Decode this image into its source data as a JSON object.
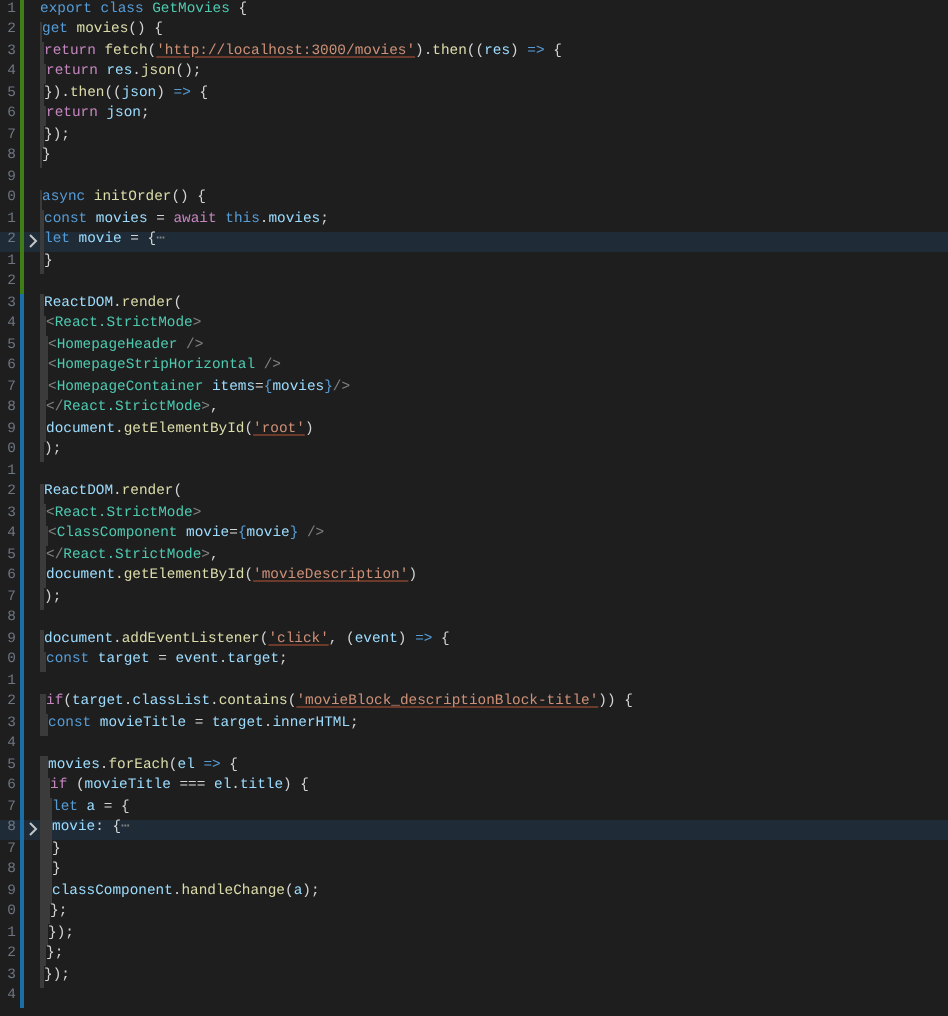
{
  "editor": {
    "lines": [
      {
        "number": "1",
        "added": true,
        "folded": false,
        "tokens": [
          {
            "kind": "kw",
            "text": "export class "
          },
          {
            "kind": "type",
            "text": "GetMovies"
          },
          {
            "kind": "p",
            "text": " {"
          }
        ]
      },
      {
        "number": "2",
        "added": true,
        "folded": false,
        "tokens": [
          {
            "kind": "kw",
            "text": "  get "
          },
          {
            "kind": "fn",
            "text": "movies"
          },
          {
            "kind": "p",
            "text": "() {"
          }
        ]
      },
      {
        "number": "3",
        "added": true,
        "folded": false,
        "tokens": [
          {
            "kind": "ctl",
            "text": "    return "
          },
          {
            "kind": "fn",
            "text": "fetch"
          },
          {
            "kind": "p",
            "text": "("
          },
          {
            "kind": "str",
            "text": "'http://localhost:3000/movies'"
          },
          {
            "kind": "p",
            "text": ")."
          },
          {
            "kind": "fn",
            "text": "then"
          },
          {
            "kind": "p",
            "text": "(("
          },
          {
            "kind": "var",
            "text": "res"
          },
          {
            "kind": "p",
            "text": ") "
          },
          {
            "kind": "kw",
            "text": "=>"
          },
          {
            "kind": "p",
            "text": " {"
          }
        ]
      },
      {
        "number": "4",
        "added": true,
        "folded": false,
        "tokens": [
          {
            "kind": "ctl",
            "text": "      return "
          },
          {
            "kind": "var",
            "text": "res"
          },
          {
            "kind": "p",
            "text": "."
          },
          {
            "kind": "fn",
            "text": "json"
          },
          {
            "kind": "p",
            "text": "();"
          }
        ]
      },
      {
        "number": "5",
        "added": true,
        "folded": false,
        "tokens": [
          {
            "kind": "p",
            "text": "    })."
          },
          {
            "kind": "fn",
            "text": "then"
          },
          {
            "kind": "p",
            "text": "(("
          },
          {
            "kind": "var",
            "text": "json"
          },
          {
            "kind": "p",
            "text": ") "
          },
          {
            "kind": "kw",
            "text": "=>"
          },
          {
            "kind": "p",
            "text": " {"
          }
        ]
      },
      {
        "number": "6",
        "added": true,
        "folded": false,
        "tokens": [
          {
            "kind": "ctl",
            "text": "      return "
          },
          {
            "kind": "var",
            "text": "json"
          },
          {
            "kind": "p",
            "text": ";"
          }
        ]
      },
      {
        "number": "7",
        "added": true,
        "folded": false,
        "tokens": [
          {
            "kind": "p",
            "text": "    });"
          }
        ]
      },
      {
        "number": "8",
        "added": true,
        "folded": false,
        "tokens": [
          {
            "kind": "p",
            "text": "  }"
          }
        ]
      },
      {
        "number": "9",
        "added": true,
        "folded": false
      },
      {
        "number": "0",
        "added": true,
        "folded": false,
        "tokens": [
          {
            "kind": "kw",
            "text": "  async "
          },
          {
            "kind": "fn",
            "text": "initOrder"
          },
          {
            "kind": "p",
            "text": "() {"
          }
        ]
      },
      {
        "number": "1",
        "added": true,
        "folded": false,
        "tokens": [
          {
            "kind": "kw",
            "text": "    const "
          },
          {
            "kind": "var",
            "text": "movies"
          },
          {
            "kind": "p",
            "text": " = "
          },
          {
            "kind": "ctl",
            "text": "await "
          },
          {
            "kind": "kw",
            "text": "this"
          },
          {
            "kind": "p",
            "text": "."
          },
          {
            "kind": "var",
            "text": "movies"
          },
          {
            "kind": "p",
            "text": ";"
          }
        ]
      },
      {
        "number": "2",
        "added": true,
        "folded": true,
        "tokens": [
          {
            "kind": "kw",
            "text": "    let "
          },
          {
            "kind": "var",
            "text": "movie"
          },
          {
            "kind": "p",
            "text": " = {"
          },
          {
            "kind": "fold",
            "text": "⋯"
          }
        ]
      },
      {
        "number": "1",
        "added": true,
        "folded": false,
        "tokens": [
          {
            "kind": "p",
            "text": "    }"
          }
        ]
      },
      {
        "number": "2",
        "added": true,
        "folded": false
      },
      {
        "number": "3",
        "added": false,
        "folded": false,
        "tokens": [
          {
            "kind": "var",
            "text": "    ReactDOM"
          },
          {
            "kind": "p",
            "text": "."
          },
          {
            "kind": "fn",
            "text": "render"
          },
          {
            "kind": "p",
            "text": "("
          }
        ]
      },
      {
        "number": "4",
        "added": false,
        "folded": false,
        "tokens": [
          {
            "kind": "tag",
            "text": "      <"
          },
          {
            "kind": "type",
            "text": "React.StrictMode"
          },
          {
            "kind": "tag",
            "text": ">"
          }
        ]
      },
      {
        "number": "5",
        "added": false,
        "folded": false,
        "tokens": [
          {
            "kind": "tag",
            "text": "        <"
          },
          {
            "kind": "type",
            "text": "HomepageHeader"
          },
          {
            "kind": "tag",
            "text": " />"
          }
        ]
      },
      {
        "number": "6",
        "added": false,
        "folded": false,
        "tokens": [
          {
            "kind": "tag",
            "text": "        <"
          },
          {
            "kind": "type",
            "text": "HomepageStripHorizontal"
          },
          {
            "kind": "tag",
            "text": " />"
          }
        ]
      },
      {
        "number": "7",
        "added": false,
        "folded": false,
        "tokens": [
          {
            "kind": "tag",
            "text": "        <"
          },
          {
            "kind": "type",
            "text": "HomepageContainer"
          },
          {
            "kind": "var",
            "text": " items"
          },
          {
            "kind": "p",
            "text": "="
          },
          {
            "kind": "kw",
            "text": "{"
          },
          {
            "kind": "var",
            "text": "movies"
          },
          {
            "kind": "kw",
            "text": "}"
          },
          {
            "kind": "tag",
            "text": "/>"
          }
        ]
      },
      {
        "number": "8",
        "added": false,
        "folded": false,
        "tokens": [
          {
            "kind": "tag",
            "text": "      </"
          },
          {
            "kind": "type",
            "text": "React.StrictMode"
          },
          {
            "kind": "tag",
            "text": ">"
          },
          {
            "kind": "p",
            "text": ","
          }
        ]
      },
      {
        "number": "9",
        "added": false,
        "folded": false,
        "tokens": [
          {
            "kind": "var",
            "text": "      document"
          },
          {
            "kind": "fn",
            "text": ".getElementById"
          },
          {
            "kind": "p",
            "text": "("
          },
          {
            "kind": "str",
            "text": "'root'"
          },
          {
            "kind": "p",
            "text": ")"
          }
        ]
      },
      {
        "number": "0",
        "added": false,
        "folded": false,
        "tokens": [
          {
            "kind": "p",
            "text": "    );"
          }
        ]
      },
      {
        "number": "1",
        "added": false,
        "folded": false
      },
      {
        "number": "2",
        "added": false,
        "folded": false,
        "tokens": [
          {
            "kind": "var",
            "text": "    ReactDOM"
          },
          {
            "kind": "p",
            "text": "."
          },
          {
            "kind": "fn",
            "text": "render"
          },
          {
            "kind": "p",
            "text": "("
          }
        ]
      },
      {
        "number": "3",
        "added": false,
        "folded": false,
        "tokens": [
          {
            "kind": "tag",
            "text": "      <"
          },
          {
            "kind": "type",
            "text": "React.StrictMode"
          },
          {
            "kind": "tag",
            "text": ">"
          }
        ]
      },
      {
        "number": "4",
        "added": false,
        "folded": false,
        "tokens": [
          {
            "kind": "tag",
            "text": "        <"
          },
          {
            "kind": "type",
            "text": "ClassComponent"
          },
          {
            "kind": "var",
            "text": " movie"
          },
          {
            "kind": "p",
            "text": "="
          },
          {
            "kind": "kw",
            "text": "{"
          },
          {
            "kind": "var",
            "text": "movie"
          },
          {
            "kind": "kw",
            "text": "}"
          },
          {
            "kind": "tag",
            "text": " />"
          }
        ]
      },
      {
        "number": "5",
        "added": false,
        "folded": false,
        "tokens": [
          {
            "kind": "tag",
            "text": "      </"
          },
          {
            "kind": "type",
            "text": "React.StrictMode"
          },
          {
            "kind": "tag",
            "text": ">"
          },
          {
            "kind": "p",
            "text": ","
          }
        ]
      },
      {
        "number": "6",
        "added": false,
        "folded": false,
        "tokens": [
          {
            "kind": "var",
            "text": "      document"
          },
          {
            "kind": "fn",
            "text": ".getElementById"
          },
          {
            "kind": "p",
            "text": "("
          },
          {
            "kind": "str",
            "text": "'movieDescription'"
          },
          {
            "kind": "p",
            "text": ")"
          }
        ]
      },
      {
        "number": "7",
        "added": false,
        "folded": false,
        "tokens": [
          {
            "kind": "p",
            "text": "    );"
          }
        ]
      },
      {
        "number": "8",
        "added": false,
        "folded": false
      },
      {
        "number": "9",
        "added": false,
        "folded": false,
        "tokens": [
          {
            "kind": "var",
            "text": "    document"
          },
          {
            "kind": "p",
            "text": "."
          },
          {
            "kind": "fn",
            "text": "addEventListener"
          },
          {
            "kind": "p",
            "text": "("
          },
          {
            "kind": "str",
            "text": "'click'"
          },
          {
            "kind": "p",
            "text": ", ("
          },
          {
            "kind": "var",
            "text": "event"
          },
          {
            "kind": "p",
            "text": ") "
          },
          {
            "kind": "kw",
            "text": "=>"
          },
          {
            "kind": "p",
            "text": " {"
          }
        ]
      },
      {
        "number": "0",
        "added": false,
        "folded": false,
        "tokens": [
          {
            "kind": "kw",
            "text": "      const "
          },
          {
            "kind": "var",
            "text": "target"
          },
          {
            "kind": "p",
            "text": " = "
          },
          {
            "kind": "var",
            "text": "event"
          },
          {
            "kind": "p",
            "text": "."
          },
          {
            "kind": "var",
            "text": "target"
          },
          {
            "kind": "p",
            "text": ";"
          }
        ]
      },
      {
        "number": "1",
        "added": false,
        "folded": false
      },
      {
        "number": "2",
        "added": false,
        "folded": false,
        "tokens": [
          {
            "kind": "ctl",
            "text": "      if"
          },
          {
            "kind": "p",
            "text": "("
          },
          {
            "kind": "var",
            "text": "target"
          },
          {
            "kind": "p",
            "text": "."
          },
          {
            "kind": "var",
            "text": "classList"
          },
          {
            "kind": "p",
            "text": "."
          },
          {
            "kind": "fn",
            "text": "contains"
          },
          {
            "kind": "p",
            "text": "("
          },
          {
            "kind": "str",
            "text": "'movieBlock_descriptionBlock-title'"
          },
          {
            "kind": "p",
            "text": ")) {"
          }
        ]
      },
      {
        "number": "3",
        "added": false,
        "folded": false,
        "tokens": [
          {
            "kind": "kw",
            "text": "        const "
          },
          {
            "kind": "var",
            "text": "movieTitle"
          },
          {
            "kind": "p",
            "text": " = "
          },
          {
            "kind": "var",
            "text": "target"
          },
          {
            "kind": "p",
            "text": "."
          },
          {
            "kind": "var",
            "text": "innerHTML"
          },
          {
            "kind": "p",
            "text": ";"
          }
        ]
      },
      {
        "number": "4",
        "added": false,
        "folded": false
      },
      {
        "number": "5",
        "added": false,
        "folded": false,
        "tokens": [
          {
            "kind": "var",
            "text": "        movies"
          },
          {
            "kind": "p",
            "text": "."
          },
          {
            "kind": "fn",
            "text": "forEach"
          },
          {
            "kind": "p",
            "text": "("
          },
          {
            "kind": "var",
            "text": "el"
          },
          {
            "kind": "kw",
            "text": " =>"
          },
          {
            "kind": "p",
            "text": " {"
          }
        ]
      },
      {
        "number": "6",
        "added": false,
        "folded": false,
        "tokens": [
          {
            "kind": "ctl",
            "text": "          if"
          },
          {
            "kind": "p",
            "text": " ("
          },
          {
            "kind": "var",
            "text": "movieTitle"
          },
          {
            "kind": "p",
            "text": " === "
          },
          {
            "kind": "var",
            "text": "el"
          },
          {
            "kind": "p",
            "text": "."
          },
          {
            "kind": "var",
            "text": "title"
          },
          {
            "kind": "p",
            "text": ") {"
          }
        ]
      },
      {
        "number": "7",
        "added": false,
        "folded": false,
        "tokens": [
          {
            "kind": "kw",
            "text": "            let "
          },
          {
            "kind": "var",
            "text": "a"
          },
          {
            "kind": "p",
            "text": " = {"
          }
        ]
      },
      {
        "number": "8",
        "added": false,
        "folded": true,
        "tokens": [
          {
            "kind": "var",
            "text": "            movie"
          },
          {
            "kind": "p",
            "text": ": {"
          },
          {
            "kind": "fold",
            "text": "⋯"
          }
        ]
      },
      {
        "number": "7",
        "added": false,
        "folded": false,
        "tokens": [
          {
            "kind": "p",
            "text": "            }"
          }
        ]
      },
      {
        "number": "8",
        "added": false,
        "folded": false,
        "tokens": [
          {
            "kind": "p",
            "text": "           }"
          }
        ]
      },
      {
        "number": "9",
        "added": false,
        "folded": false,
        "tokens": [
          {
            "kind": "var",
            "text": "            classComponent"
          },
          {
            "kind": "p",
            "text": "."
          },
          {
            "kind": "fn",
            "text": "handleChange"
          },
          {
            "kind": "p",
            "text": "("
          },
          {
            "kind": "var",
            "text": "a"
          },
          {
            "kind": "p",
            "text": ");"
          }
        ]
      },
      {
        "number": "0",
        "added": false,
        "folded": false,
        "tokens": [
          {
            "kind": "p",
            "text": "          };"
          }
        ]
      },
      {
        "number": "1",
        "added": false,
        "folded": false,
        "tokens": [
          {
            "kind": "p",
            "text": "        });"
          }
        ]
      },
      {
        "number": "2",
        "added": false,
        "folded": false,
        "tokens": [
          {
            "kind": "p",
            "text": "      };"
          }
        ]
      },
      {
        "number": "3",
        "added": false,
        "folded": false,
        "tokens": [
          {
            "kind": "p",
            "text": "    });"
          }
        ]
      },
      {
        "number": "4",
        "added": false,
        "folded": false
      }
    ]
  }
}
